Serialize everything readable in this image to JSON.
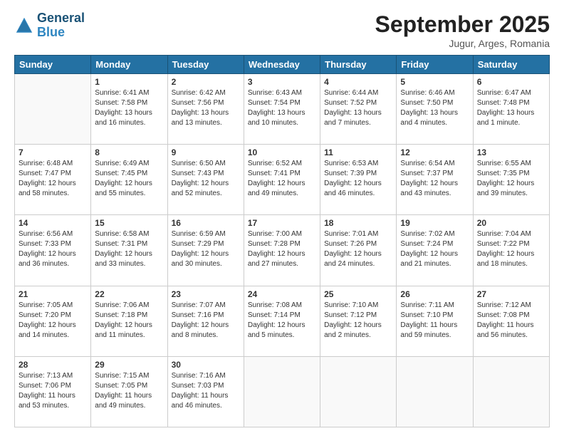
{
  "header": {
    "logo_line1": "General",
    "logo_line2": "Blue",
    "month_title": "September 2025",
    "subtitle": "Jugur, Arges, Romania"
  },
  "weekdays": [
    "Sunday",
    "Monday",
    "Tuesday",
    "Wednesday",
    "Thursday",
    "Friday",
    "Saturday"
  ],
  "weeks": [
    [
      {
        "day": "",
        "empty": true
      },
      {
        "day": "1",
        "sunrise": "Sunrise: 6:41 AM",
        "sunset": "Sunset: 7:58 PM",
        "daylight": "Daylight: 13 hours and 16 minutes."
      },
      {
        "day": "2",
        "sunrise": "Sunrise: 6:42 AM",
        "sunset": "Sunset: 7:56 PM",
        "daylight": "Daylight: 13 hours and 13 minutes."
      },
      {
        "day": "3",
        "sunrise": "Sunrise: 6:43 AM",
        "sunset": "Sunset: 7:54 PM",
        "daylight": "Daylight: 13 hours and 10 minutes."
      },
      {
        "day": "4",
        "sunrise": "Sunrise: 6:44 AM",
        "sunset": "Sunset: 7:52 PM",
        "daylight": "Daylight: 13 hours and 7 minutes."
      },
      {
        "day": "5",
        "sunrise": "Sunrise: 6:46 AM",
        "sunset": "Sunset: 7:50 PM",
        "daylight": "Daylight: 13 hours and 4 minutes."
      },
      {
        "day": "6",
        "sunrise": "Sunrise: 6:47 AM",
        "sunset": "Sunset: 7:48 PM",
        "daylight": "Daylight: 13 hours and 1 minute."
      }
    ],
    [
      {
        "day": "7",
        "sunrise": "Sunrise: 6:48 AM",
        "sunset": "Sunset: 7:47 PM",
        "daylight": "Daylight: 12 hours and 58 minutes."
      },
      {
        "day": "8",
        "sunrise": "Sunrise: 6:49 AM",
        "sunset": "Sunset: 7:45 PM",
        "daylight": "Daylight: 12 hours and 55 minutes."
      },
      {
        "day": "9",
        "sunrise": "Sunrise: 6:50 AM",
        "sunset": "Sunset: 7:43 PM",
        "daylight": "Daylight: 12 hours and 52 minutes."
      },
      {
        "day": "10",
        "sunrise": "Sunrise: 6:52 AM",
        "sunset": "Sunset: 7:41 PM",
        "daylight": "Daylight: 12 hours and 49 minutes."
      },
      {
        "day": "11",
        "sunrise": "Sunrise: 6:53 AM",
        "sunset": "Sunset: 7:39 PM",
        "daylight": "Daylight: 12 hours and 46 minutes."
      },
      {
        "day": "12",
        "sunrise": "Sunrise: 6:54 AM",
        "sunset": "Sunset: 7:37 PM",
        "daylight": "Daylight: 12 hours and 43 minutes."
      },
      {
        "day": "13",
        "sunrise": "Sunrise: 6:55 AM",
        "sunset": "Sunset: 7:35 PM",
        "daylight": "Daylight: 12 hours and 39 minutes."
      }
    ],
    [
      {
        "day": "14",
        "sunrise": "Sunrise: 6:56 AM",
        "sunset": "Sunset: 7:33 PM",
        "daylight": "Daylight: 12 hours and 36 minutes."
      },
      {
        "day": "15",
        "sunrise": "Sunrise: 6:58 AM",
        "sunset": "Sunset: 7:31 PM",
        "daylight": "Daylight: 12 hours and 33 minutes."
      },
      {
        "day": "16",
        "sunrise": "Sunrise: 6:59 AM",
        "sunset": "Sunset: 7:29 PM",
        "daylight": "Daylight: 12 hours and 30 minutes."
      },
      {
        "day": "17",
        "sunrise": "Sunrise: 7:00 AM",
        "sunset": "Sunset: 7:28 PM",
        "daylight": "Daylight: 12 hours and 27 minutes."
      },
      {
        "day": "18",
        "sunrise": "Sunrise: 7:01 AM",
        "sunset": "Sunset: 7:26 PM",
        "daylight": "Daylight: 12 hours and 24 minutes."
      },
      {
        "day": "19",
        "sunrise": "Sunrise: 7:02 AM",
        "sunset": "Sunset: 7:24 PM",
        "daylight": "Daylight: 12 hours and 21 minutes."
      },
      {
        "day": "20",
        "sunrise": "Sunrise: 7:04 AM",
        "sunset": "Sunset: 7:22 PM",
        "daylight": "Daylight: 12 hours and 18 minutes."
      }
    ],
    [
      {
        "day": "21",
        "sunrise": "Sunrise: 7:05 AM",
        "sunset": "Sunset: 7:20 PM",
        "daylight": "Daylight: 12 hours and 14 minutes."
      },
      {
        "day": "22",
        "sunrise": "Sunrise: 7:06 AM",
        "sunset": "Sunset: 7:18 PM",
        "daylight": "Daylight: 12 hours and 11 minutes."
      },
      {
        "day": "23",
        "sunrise": "Sunrise: 7:07 AM",
        "sunset": "Sunset: 7:16 PM",
        "daylight": "Daylight: 12 hours and 8 minutes."
      },
      {
        "day": "24",
        "sunrise": "Sunrise: 7:08 AM",
        "sunset": "Sunset: 7:14 PM",
        "daylight": "Daylight: 12 hours and 5 minutes."
      },
      {
        "day": "25",
        "sunrise": "Sunrise: 7:10 AM",
        "sunset": "Sunset: 7:12 PM",
        "daylight": "Daylight: 12 hours and 2 minutes."
      },
      {
        "day": "26",
        "sunrise": "Sunrise: 7:11 AM",
        "sunset": "Sunset: 7:10 PM",
        "daylight": "Daylight: 11 hours and 59 minutes."
      },
      {
        "day": "27",
        "sunrise": "Sunrise: 7:12 AM",
        "sunset": "Sunset: 7:08 PM",
        "daylight": "Daylight: 11 hours and 56 minutes."
      }
    ],
    [
      {
        "day": "28",
        "sunrise": "Sunrise: 7:13 AM",
        "sunset": "Sunset: 7:06 PM",
        "daylight": "Daylight: 11 hours and 53 minutes."
      },
      {
        "day": "29",
        "sunrise": "Sunrise: 7:15 AM",
        "sunset": "Sunset: 7:05 PM",
        "daylight": "Daylight: 11 hours and 49 minutes."
      },
      {
        "day": "30",
        "sunrise": "Sunrise: 7:16 AM",
        "sunset": "Sunset: 7:03 PM",
        "daylight": "Daylight: 11 hours and 46 minutes."
      },
      {
        "day": "",
        "empty": true
      },
      {
        "day": "",
        "empty": true
      },
      {
        "day": "",
        "empty": true
      },
      {
        "day": "",
        "empty": true
      }
    ]
  ]
}
